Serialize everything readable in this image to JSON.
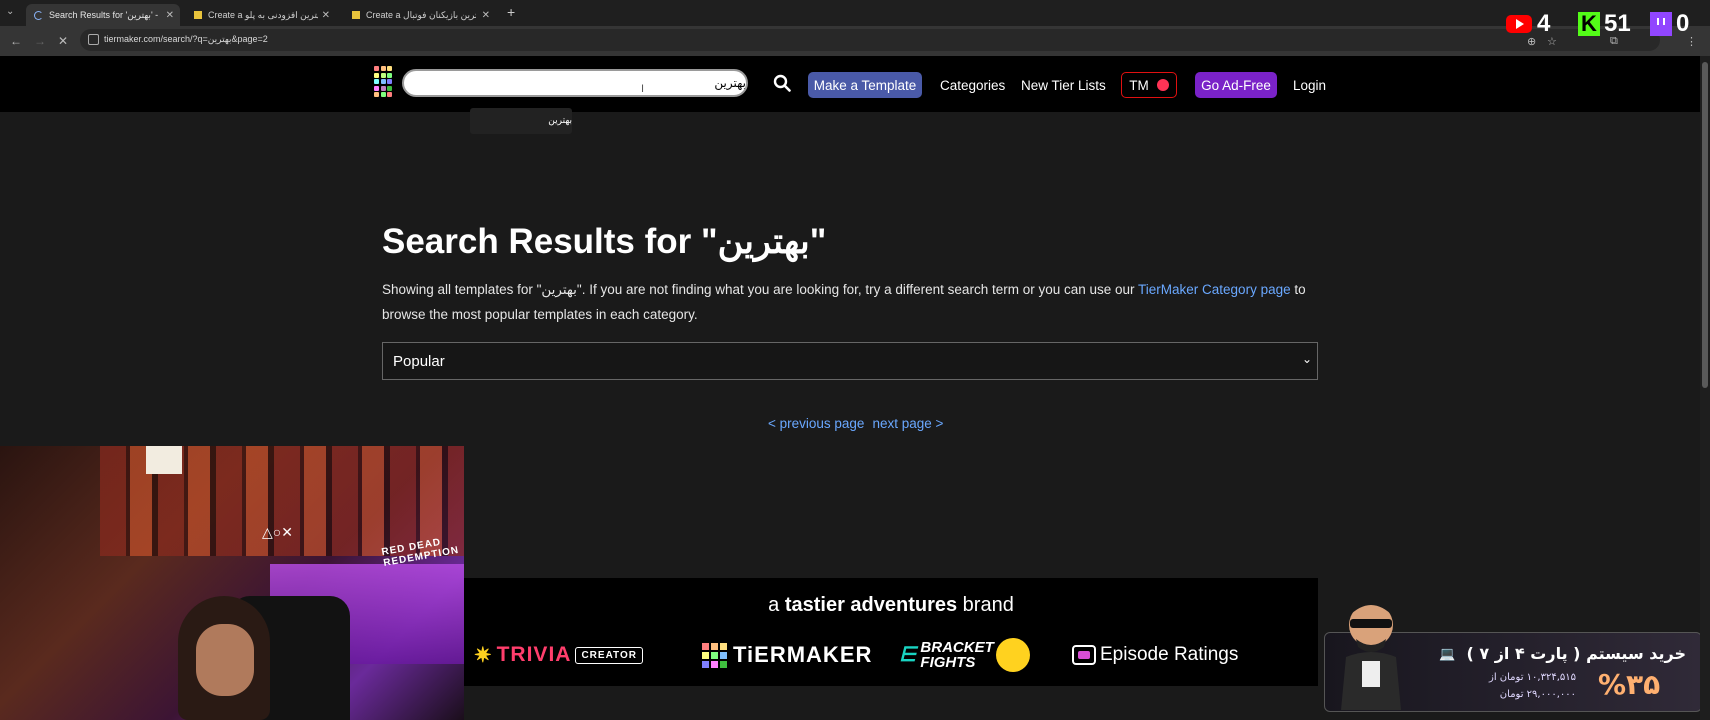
{
  "browser": {
    "tabs": [
      {
        "title": "Search Results for 'بهترین' - Tier",
        "active": true
      },
      {
        "title": "Create a بهترین افزودنی به پلو Ti",
        "active": false
      },
      {
        "title": "Create a بهترین بازیکنان فوتبال Ti",
        "active": false
      }
    ],
    "url": "tiermaker.com/search/?q=بهترین&page=2"
  },
  "stream_overlay": {
    "youtube_count": "4",
    "kick_count": "51",
    "twitch_count": "0"
  },
  "header": {
    "search_value": "بهترین",
    "make_template": "Make a Template",
    "categories": "Categories",
    "new_tier_lists": "New Tier Lists",
    "tm": "TM",
    "go_ad_free": "Go Ad-Free",
    "login": "Login",
    "suggestion": "بهترین"
  },
  "main": {
    "title": "Search Results for \"بهترین\"",
    "desc_before": "Showing all templates for \"بهترین\". If you are not finding what you are looking for, try a different search term or you can use our ",
    "desc_link": "TierMaker Category page",
    "desc_after": " to browse the most popular templates in each category.",
    "sort_selected": "Popular",
    "prev_page": "< previous page",
    "next_page": "next page >"
  },
  "brand": {
    "line_a": "a ",
    "line_b": "tastier adventures",
    "line_c": " brand",
    "trivia": "TRIVIA",
    "creator": "CREATOR",
    "tiermaker": "TiERMAKER",
    "bracket_1": "BRACKET",
    "bracket_2": "FIGHTS",
    "episode": "Episode Ratings"
  },
  "webcam": {
    "sign": "RED DEAD REDEMPTION"
  },
  "promo": {
    "title": "خرید سیستم ( پارت ۴ از ۷ )",
    "line1": "۱۰,۳۲۴,۵۱۵ تومان از",
    "line2": "۲۹,۰۰۰,۰۰۰ تومان",
    "percent": "%۳۵"
  },
  "colors": {
    "link": "#6aa8ff",
    "make_template_bg": "#4a5aa8",
    "ad_free_bg": "#7a22c8",
    "tm_border": "#e01010"
  }
}
